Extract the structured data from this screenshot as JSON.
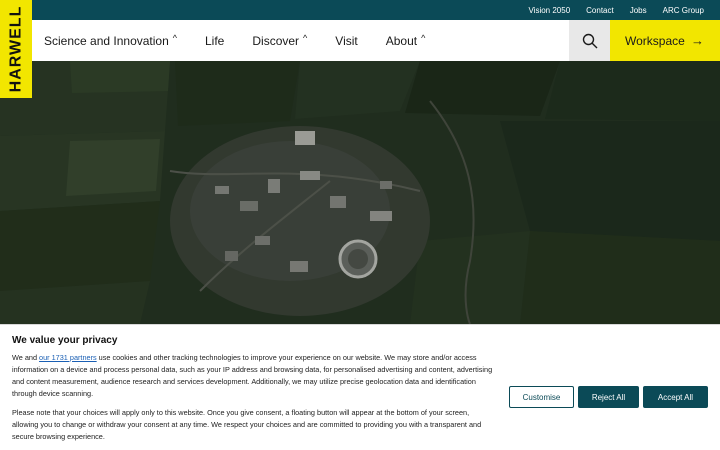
{
  "brand": {
    "logo_text": "HARWELL"
  },
  "utility_links": [
    "Vision 2050",
    "Contact",
    "Jobs",
    "ARC Group"
  ],
  "nav": {
    "items": [
      {
        "label": "Science and Innovation",
        "caret": "^"
      },
      {
        "label": "Life",
        "caret": ""
      },
      {
        "label": "Discover",
        "caret": "^"
      },
      {
        "label": "Visit",
        "caret": ""
      },
      {
        "label": "About",
        "caret": "^"
      }
    ],
    "workspace_label": "Workspace",
    "workspace_arrow": "→"
  },
  "cookie": {
    "title": "We value your privacy",
    "p1_before": "We and ",
    "p1_link": "our 1731 partners",
    "p1_after": " use cookies and other tracking technologies to improve your experience on our website. We may store and/or access information on a device and process personal data, such as your IP address and browsing data, for personalised advertising and content, advertising and content measurement, audience research and services development. Additionally, we may utilize precise geolocation data and identification through device scanning.",
    "p2": "Please note that your choices will apply only to this website. Once you give consent, a floating button will appear at the bottom of your screen, allowing you to change or withdraw your consent at any time. We respect your choices and are committed to providing you with a transparent and secure browsing experience.",
    "customise_label": "Customise",
    "reject_label": "Reject All",
    "accept_label": "Accept All"
  },
  "colors": {
    "teal": "#0b4a57",
    "yellow": "#f2e600"
  },
  "icons": {
    "search": "search-icon",
    "workspace_arrow": "arrow-right-icon"
  }
}
